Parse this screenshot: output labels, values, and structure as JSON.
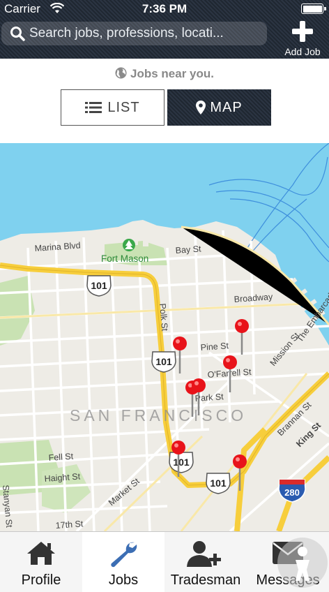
{
  "status": {
    "carrier": "Carrier",
    "time": "7:36 PM"
  },
  "header": {
    "search_placeholder": "Search jobs, professions, locati...",
    "add_job_label": "Add Job"
  },
  "near": {
    "text": "Jobs near you."
  },
  "view_toggle": {
    "list_label": "LIST",
    "map_label": "MAP",
    "selected": "MAP"
  },
  "map": {
    "labels": [
      "Marina Blvd",
      "Fort Mason",
      "Bay St",
      "Broadway",
      "Pine St",
      "Polk St",
      "O'Farrell St",
      "Park St",
      "SAN FRANCISCO",
      "Fell St",
      "Haight St",
      "Market St",
      "Stanyan St",
      "17th St",
      "Brannan St",
      "King St",
      "Mission St",
      "The Embarcadero"
    ],
    "shields": [
      "101",
      "101",
      "101",
      "101",
      "280"
    ],
    "pin_count": 7
  },
  "tabs": [
    {
      "label": "Profile",
      "icon": "home-icon"
    },
    {
      "label": "Jobs",
      "icon": "wrench-icon",
      "active": true
    },
    {
      "label": "Tradesman",
      "icon": "add-user-icon"
    },
    {
      "label": "Messages",
      "icon": "envelope-icon"
    }
  ],
  "colors": {
    "header": "#232b36",
    "pin": "#e8131a",
    "highway": "#f7ce3c",
    "water": "#7ed0ee",
    "tab_active_icon": "#3c6eb4"
  }
}
